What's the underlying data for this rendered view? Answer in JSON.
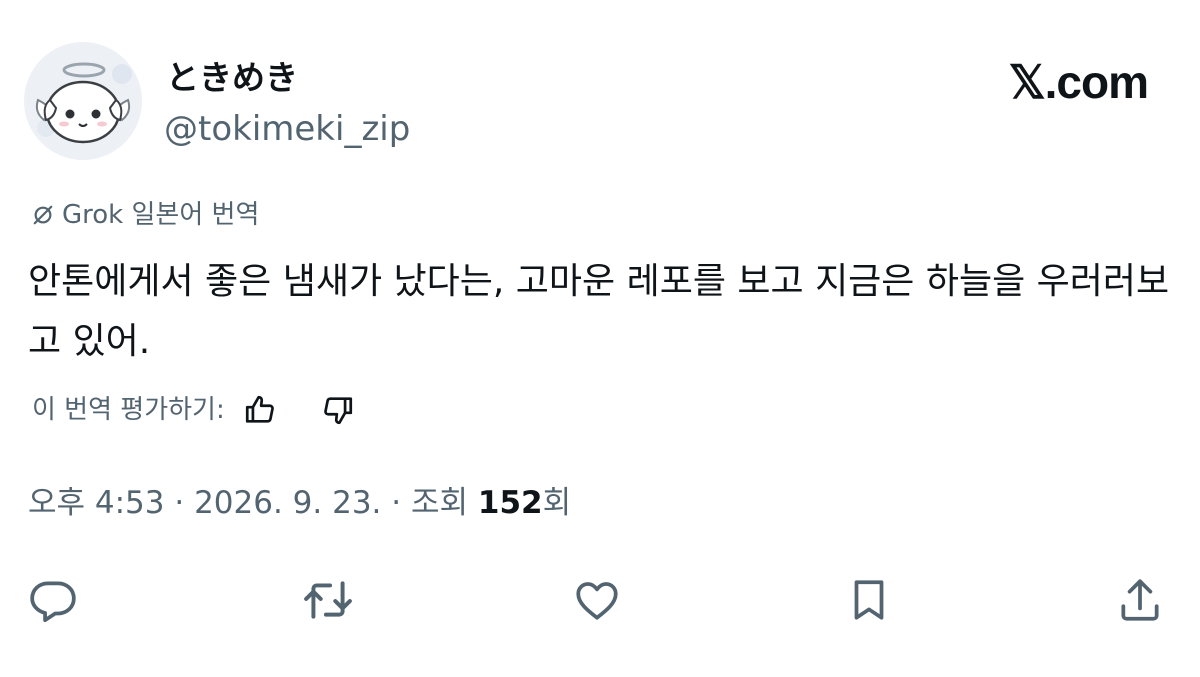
{
  "author": {
    "display_name": "ときめき",
    "handle": "@tokimeki_zip"
  },
  "brand": "𝕏.com",
  "translation": {
    "icon": "grok-icon",
    "label": "Grok 일본어 번역"
  },
  "tweet": {
    "text": "안톤에게서 좋은 냄새가 났다는, 고마운 레포를 보고 지금은 하늘을 우러러보고 있어."
  },
  "rating": {
    "prompt": "이 번역 평가하기:"
  },
  "meta": {
    "time": "오후 4:53",
    "sep1": " · ",
    "date": "2026. 9. 23.",
    "sep2": " · ",
    "views_prefix": "조회 ",
    "views_count": "152",
    "views_suffix": "회"
  },
  "actions": [
    "reply-icon",
    "retweet-icon",
    "like-icon",
    "bookmark-icon",
    "share-icon"
  ],
  "colors": {
    "text": "#0f1419",
    "secondary": "#536471"
  }
}
